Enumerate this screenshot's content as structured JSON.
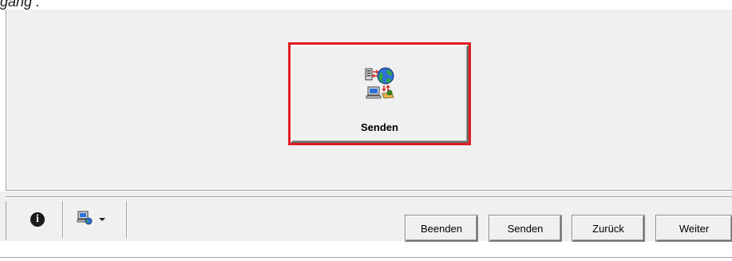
{
  "header": {
    "caption_text": "gang ."
  },
  "main": {
    "action_button": {
      "label": "Senden",
      "icon": "network-send-icon",
      "highlight_color": "#e11b22"
    }
  },
  "toolbar": {
    "info_icon": "info-icon",
    "info_glyph": "i",
    "network_icon": "network-computer-icon",
    "dropdown_icon": "chevron-down-icon"
  },
  "nav_buttons": {
    "exit": "Beenden",
    "send": "Senden",
    "back": "Zurück",
    "next": "Weiter"
  }
}
